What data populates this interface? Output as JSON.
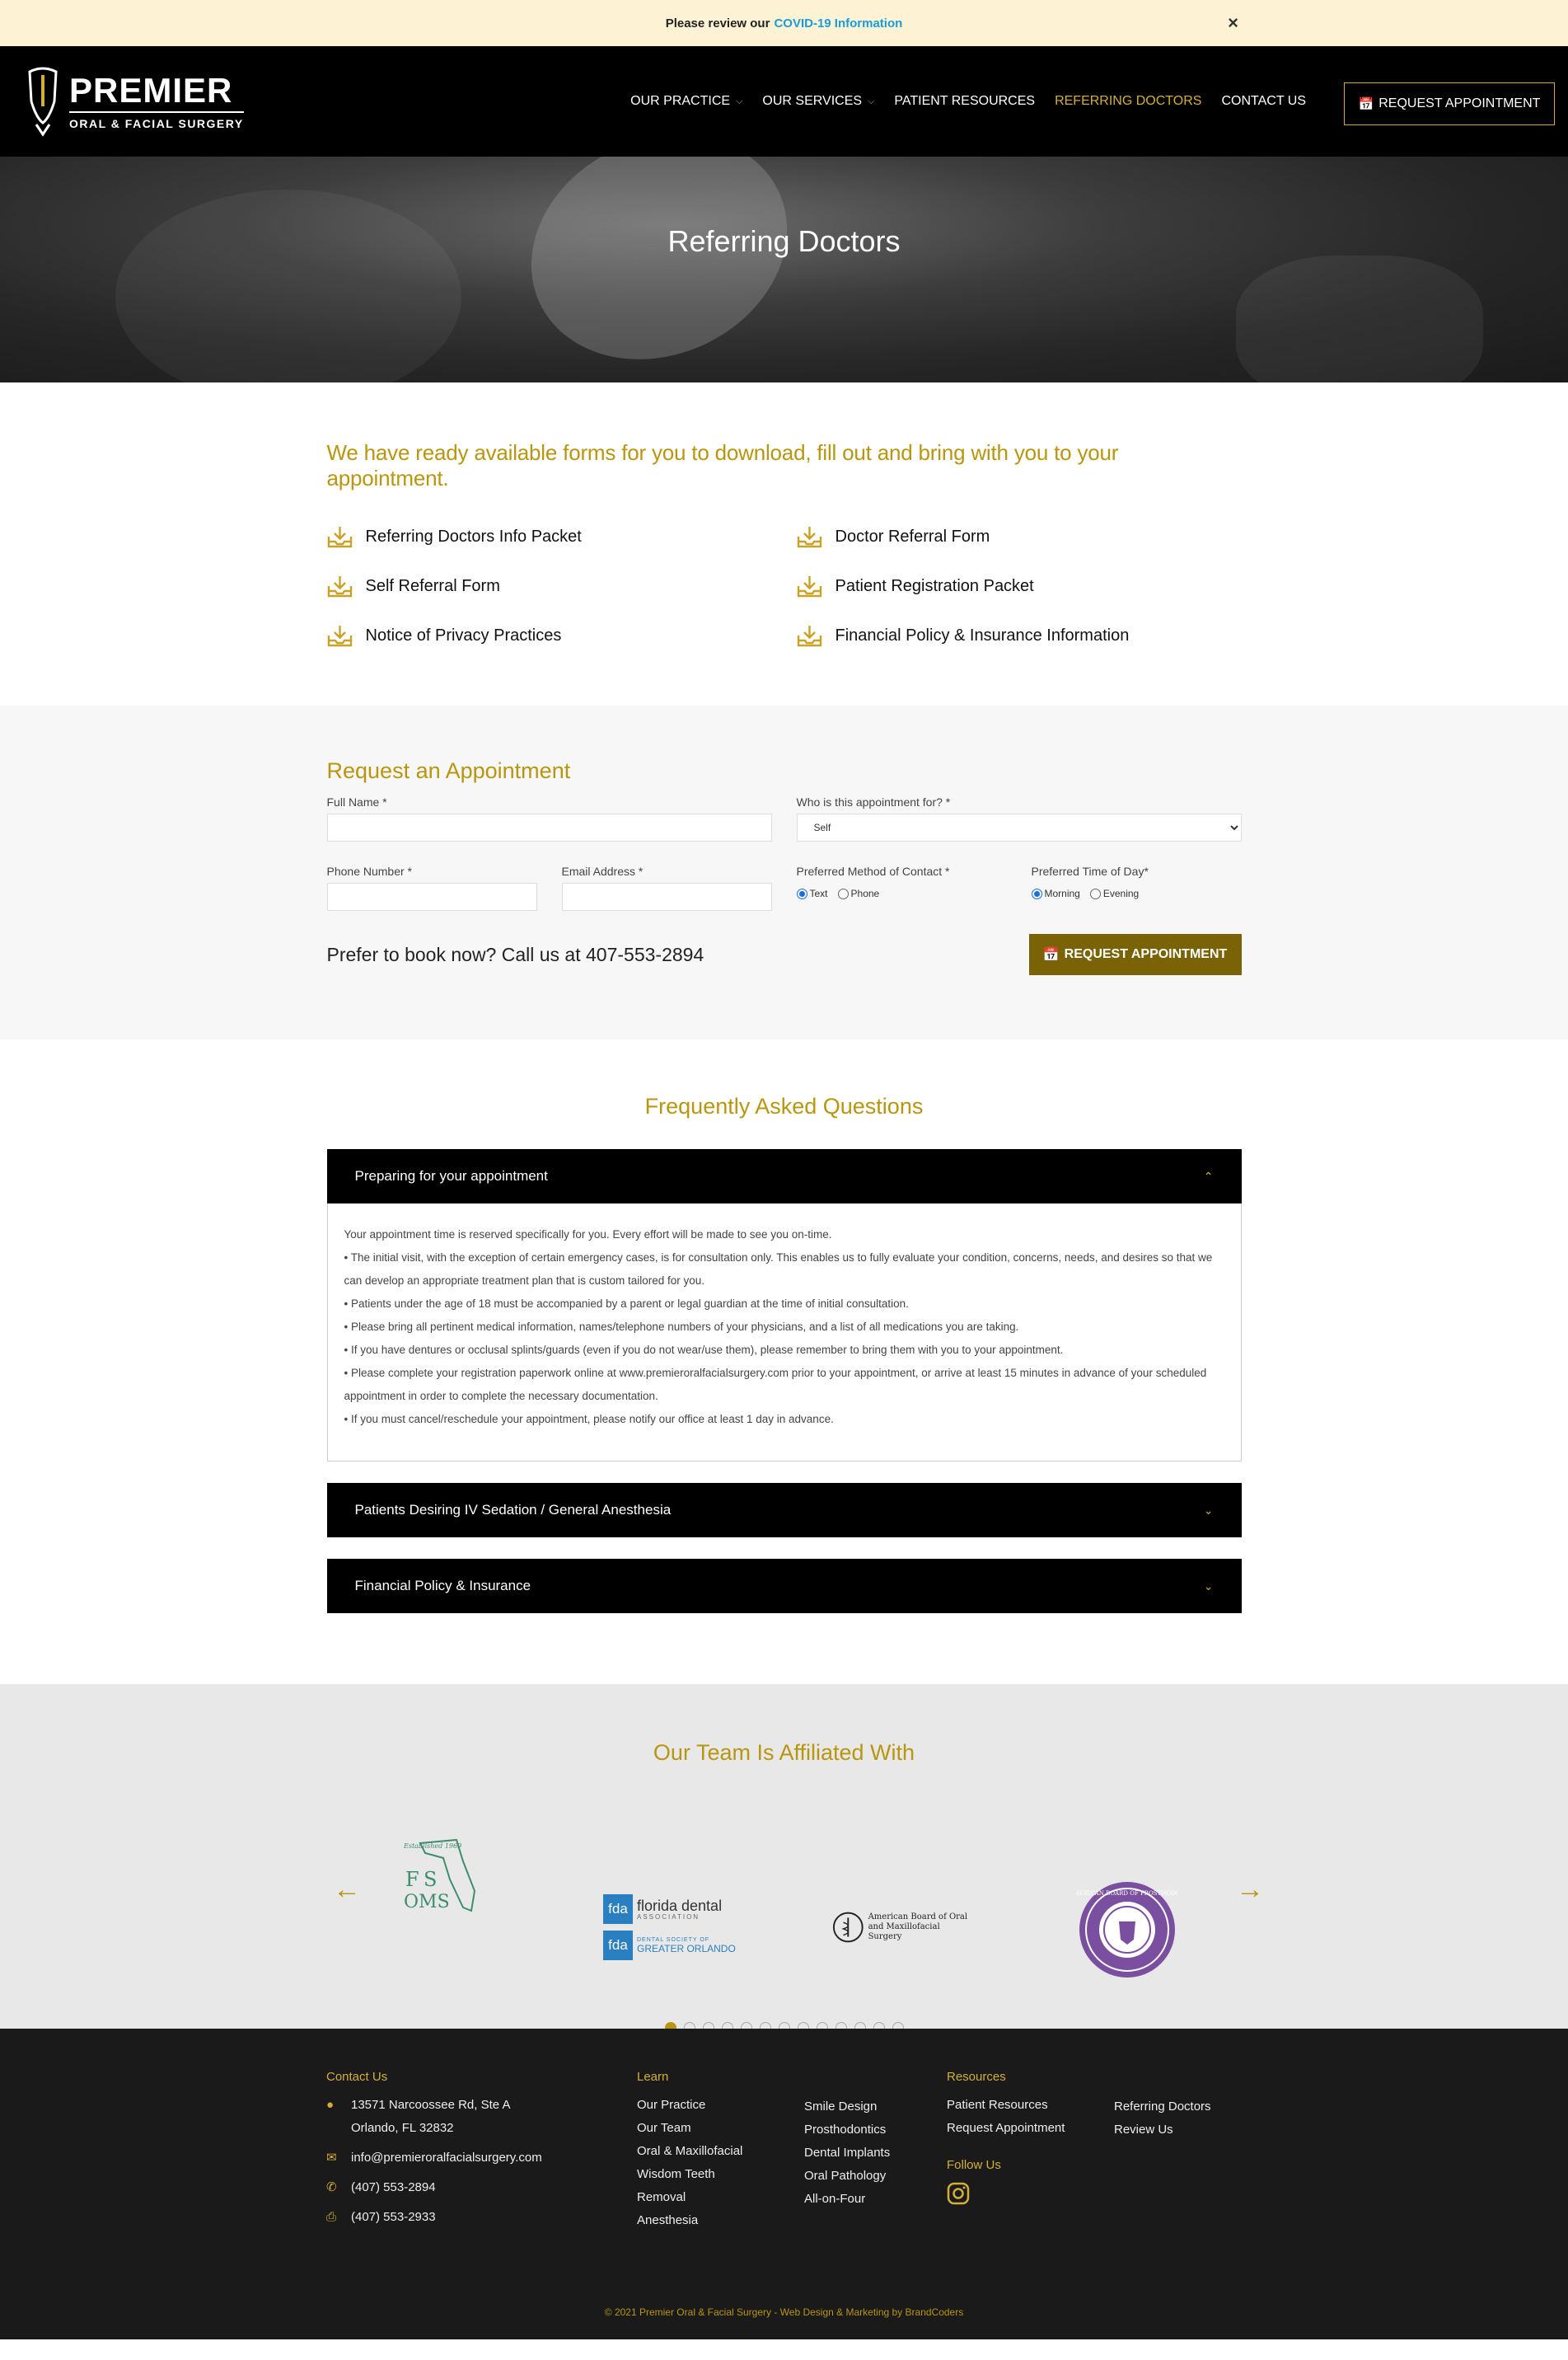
{
  "covid": {
    "text": "Please review our",
    "link": "COVID-19 Information",
    "close": "×"
  },
  "header": {
    "logo_title": "PREMIER",
    "logo_subtitle": "ORAL & FACIAL SURGERY",
    "nav": [
      {
        "label": "OUR PRACTICE",
        "dropdown": true
      },
      {
        "label": "OUR SERVICES",
        "dropdown": true
      },
      {
        "label": "PATIENT RESOURCES",
        "dropdown": false
      },
      {
        "label": "REFERRING DOCTORS",
        "dropdown": false,
        "active": true
      },
      {
        "label": "CONTACT US",
        "dropdown": false
      }
    ],
    "cta": "REQUEST APPOINTMENT"
  },
  "hero": {
    "title": "Referring Doctors"
  },
  "forms": {
    "heading": "We have ready available forms for you to download, fill out and bring with you to your appointment.",
    "items": [
      "Referring Doctors Info Packet",
      "Doctor Referral Form",
      "Self Referral Form",
      "Patient Registration Packet",
      "Notice of Privacy Practices",
      "Financial Policy & Insurance Information"
    ]
  },
  "appointment": {
    "heading": "Request an Appointment",
    "full_name_label": "Full Name *",
    "who_label": "Who is this appointment for? *",
    "who_value": "Self",
    "phone_label": "Phone Number *",
    "email_label": "Email Address *",
    "method_label": "Preferred Method of Contact *",
    "method_options": [
      "Text",
      "Phone"
    ],
    "time_label": "Preferred Time of Day*",
    "time_options": [
      "Morning",
      "Evening"
    ],
    "call_text": "Prefer to book now? Call us at 407-553-2894",
    "submit": "REQUEST APPOINTMENT"
  },
  "faq": {
    "heading": "Frequently Asked Questions",
    "items": [
      {
        "title": "Preparing for your appointment",
        "lines": [
          "Your appointment time is reserved specifically for you. Every effort will be made to see you on-time.",
          "• The initial visit, with the exception of certain emergency cases, is for consultation only. This enables us to fully evaluate your condition, concerns, needs, and desires so that we can develop an appropriate treatment plan that is custom tailored for you.",
          "• Patients under the age of 18 must be accompanied by a parent or legal guardian at the time of initial consultation.",
          "• Please bring all pertinent medical information, names/telephone numbers of your physicians, and a list of all medications you are taking.",
          "• If you have dentures or occlusal splints/guards (even if you do not wear/use them), please remember to bring them with you to your appointment.",
          "• Please complete your registration paperwork online at www.premieroralfacialsurgery.com prior to your appointment, or arrive at least 15 minutes in advance of your scheduled appointment in order to complete the necessary documentation.",
          "• If you must cancel/reschedule your appointment, please notify our office at least 1 day in advance."
        ]
      },
      {
        "title": "Patients Desiring IV Sedation / General Anesthesia"
      },
      {
        "title": "Financial Policy & Insurance"
      }
    ]
  },
  "affiliations": {
    "heading": "Our Team Is Affiliated With",
    "logos": [
      {
        "text_top": "Established 1969",
        "text_main": "FSOMS"
      },
      {
        "text_a": "florida dental",
        "text_b": "ASSOCIATION",
        "text_c": "DENTAL SOCIETY OF",
        "text_d": "GREATER ORLANDO",
        "abbr": "fda"
      },
      {
        "text_a": "American Board of Oral",
        "text_b": "and Maxillofacial Surgery"
      },
      {
        "text_a": "THE AMERICAN BOARD OF PROSTHODONTICS"
      }
    ],
    "dot_count": 13
  },
  "footer": {
    "contact_heading": "Contact Us",
    "address1": "13571 Narcoossee Rd, Ste A",
    "address2": "Orlando, FL 32832",
    "email": "info@premieroralfacialsurgery.com",
    "phone": "(407) 553-2894",
    "fax": "(407) 553-2933",
    "learn_heading": "Learn",
    "learn_col1": [
      "Our Practice",
      "Our Team",
      "Oral & Maxillofacial",
      "Wisdom Teeth",
      "Removal",
      "Anesthesia"
    ],
    "learn_col2": [
      "Smile Design",
      "Prosthodontics",
      "Dental Implants",
      "Oral Pathology",
      "All-on-Four"
    ],
    "resources_heading": "Resources",
    "resources_col1": [
      "Patient Resources",
      "Request Appointment"
    ],
    "resources_col2": [
      "Referring Doctors",
      "Review Us"
    ],
    "follow_heading": "Follow Us",
    "copyright": "© 2021 Premier Oral & Facial Surgery - Web Design & Marketing by BrandCoders"
  },
  "colors": {
    "gold": "#b8960f",
    "gold_button": "#7a6206",
    "link_blue": "#1a9cd8",
    "footer_bg": "#1a1a1a"
  }
}
